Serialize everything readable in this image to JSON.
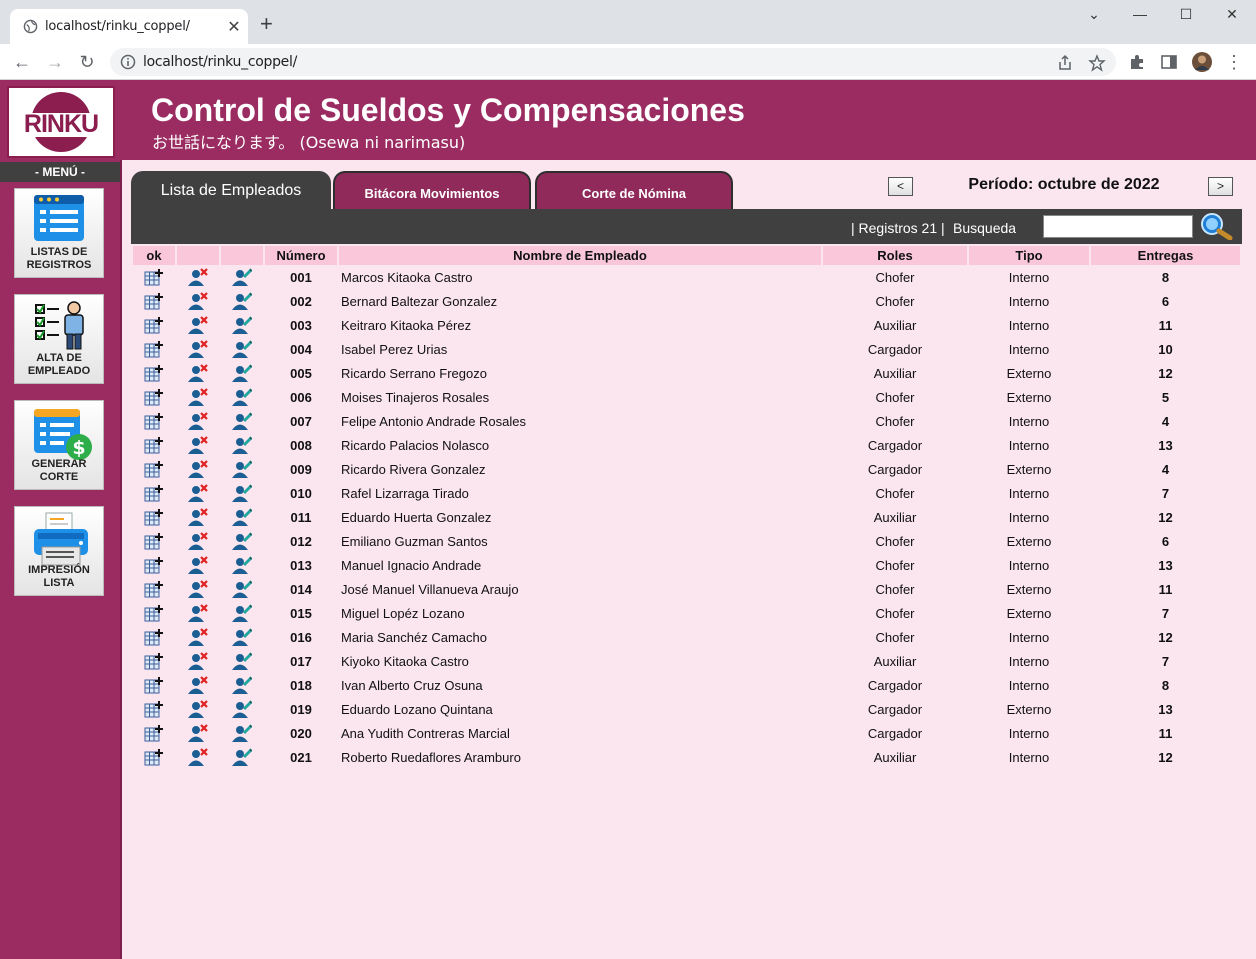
{
  "browser": {
    "tab_title": "localhost/rinku_coppel/",
    "url": "localhost/rinku_coppel/"
  },
  "header": {
    "logo_text": "RINKU",
    "title": "Control de Sueldos y Compensaciones",
    "subtitle": "お世話になります。 (Osewa ni narimasu)"
  },
  "sidebar": {
    "menu_label": "- MENÚ -",
    "items": [
      {
        "label": "LISTAS DE REGISTROS",
        "icon": "list-icon"
      },
      {
        "label": "ALTA DE EMPLEADO",
        "icon": "employee-checklist-icon"
      },
      {
        "label": "GENERAR CORTE",
        "icon": "payroll-money-icon"
      },
      {
        "label": "IMPRESIÓN LISTA",
        "icon": "printer-icon"
      }
    ]
  },
  "tabs": [
    {
      "label": "Lista de Empleados",
      "active": true
    },
    {
      "label": "Bitácora Movimientos",
      "active": false
    },
    {
      "label": "Corte de Nómina",
      "active": false
    }
  ],
  "period": {
    "prev_label": "<",
    "next_label": ">",
    "label": "Período: octubre de 2022"
  },
  "gridbar": {
    "registros": "|  Registros 21   |",
    "busqueda_label": "Busqueda",
    "search_value": ""
  },
  "colors": {
    "brand": "#9b2c61",
    "page_bg": "#fbe6ef",
    "header_row": "#f9c6da",
    "dark_bar": "#404040"
  },
  "table": {
    "headers": [
      "ok",
      "",
      "",
      "Número",
      "Nombre de Empleado",
      "Roles",
      "Tipo",
      "Entregas"
    ],
    "rows": [
      {
        "numero": "001",
        "nombre": "Marcos Kitaoka Castro",
        "rol": "Chofer",
        "tipo": "Interno",
        "entregas": "8"
      },
      {
        "numero": "002",
        "nombre": "Bernard Baltezar Gonzalez",
        "rol": "Chofer",
        "tipo": "Interno",
        "entregas": "6"
      },
      {
        "numero": "003",
        "nombre": "Keitraro Kitaoka Pérez",
        "rol": "Auxiliar",
        "tipo": "Interno",
        "entregas": "11"
      },
      {
        "numero": "004",
        "nombre": "Isabel Perez Urias",
        "rol": "Cargador",
        "tipo": "Interno",
        "entregas": "10"
      },
      {
        "numero": "005",
        "nombre": "Ricardo Serrano Fregozo",
        "rol": "Auxiliar",
        "tipo": "Externo",
        "entregas": "12"
      },
      {
        "numero": "006",
        "nombre": "Moises Tinajeros Rosales",
        "rol": "Chofer",
        "tipo": "Externo",
        "entregas": "5"
      },
      {
        "numero": "007",
        "nombre": "Felipe Antonio Andrade Rosales",
        "rol": "Chofer",
        "tipo": "Interno",
        "entregas": "4"
      },
      {
        "numero": "008",
        "nombre": "Ricardo Palacios Nolasco",
        "rol": "Cargador",
        "tipo": "Interno",
        "entregas": "13"
      },
      {
        "numero": "009",
        "nombre": "Ricardo Rivera Gonzalez",
        "rol": "Cargador",
        "tipo": "Externo",
        "entregas": "4"
      },
      {
        "numero": "010",
        "nombre": "Rafel Lizarraga Tirado",
        "rol": "Chofer",
        "tipo": "Interno",
        "entregas": "7"
      },
      {
        "numero": "011",
        "nombre": "Eduardo Huerta Gonzalez",
        "rol": "Auxiliar",
        "tipo": "Interno",
        "entregas": "12"
      },
      {
        "numero": "012",
        "nombre": "Emiliano Guzman Santos",
        "rol": "Chofer",
        "tipo": "Externo",
        "entregas": "6"
      },
      {
        "numero": "013",
        "nombre": "Manuel Ignacio Andrade",
        "rol": "Chofer",
        "tipo": "Interno",
        "entregas": "13"
      },
      {
        "numero": "014",
        "nombre": "José Manuel Villanueva Araujo",
        "rol": "Chofer",
        "tipo": "Externo",
        "entregas": "11"
      },
      {
        "numero": "015",
        "nombre": "Miguel Lopéz Lozano",
        "rol": "Chofer",
        "tipo": "Externo",
        "entregas": "7"
      },
      {
        "numero": "016",
        "nombre": "Maria Sanchéz Camacho",
        "rol": "Chofer",
        "tipo": "Interno",
        "entregas": "12"
      },
      {
        "numero": "017",
        "nombre": "Kiyoko Kitaoka Castro",
        "rol": "Auxiliar",
        "tipo": "Interno",
        "entregas": "7"
      },
      {
        "numero": "018",
        "nombre": "Ivan Alberto Cruz Osuna",
        "rol": "Cargador",
        "tipo": "Interno",
        "entregas": "8"
      },
      {
        "numero": "019",
        "nombre": "Eduardo Lozano Quintana",
        "rol": "Cargador",
        "tipo": "Externo",
        "entregas": "13"
      },
      {
        "numero": "020",
        "nombre": "Ana Yudith Contreras Marcial",
        "rol": "Cargador",
        "tipo": "Interno",
        "entregas": "11"
      },
      {
        "numero": "021",
        "nombre": "Roberto Ruedaflores Aramburo",
        "rol": "Auxiliar",
        "tipo": "Interno",
        "entregas": "12"
      }
    ]
  }
}
